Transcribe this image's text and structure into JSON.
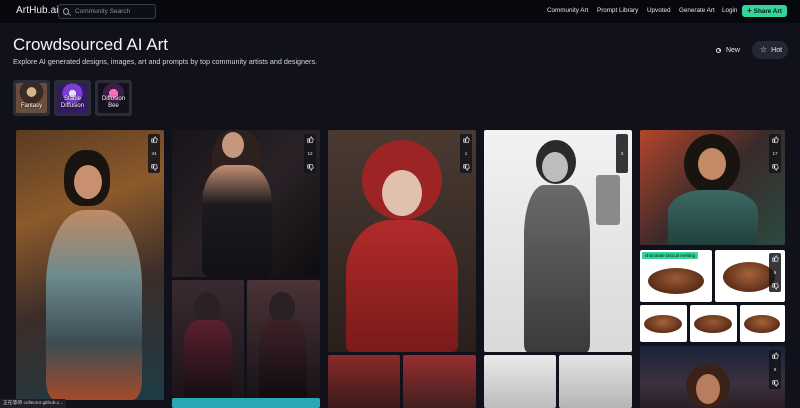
{
  "header": {
    "logo": "ArtHub.ai",
    "search_placeholder": "Community Search",
    "nav": [
      "Community Art",
      "Prompt Library",
      "Upvoted",
      "Generate Art",
      "Login"
    ],
    "share_label": "Share Art"
  },
  "hero": {
    "title": "Crowdsourced AI Art",
    "subtitle": "Explore AI generated designs, images, art and prompts by top community artists and designers."
  },
  "sort": {
    "new_label": "New",
    "hot_label": "Hot"
  },
  "categories": [
    {
      "lines": [
        "Fantasy"
      ]
    },
    {
      "lines": [
        "Stable",
        "Diffusion"
      ]
    },
    {
      "lines": [
        "Diffusion",
        "Bee"
      ]
    }
  ],
  "cards": {
    "votes": [
      "44",
      "12",
      "1",
      "3",
      "17",
      "6",
      "9"
    ],
    "tag": "chocolate biscuit melting"
  },
  "statusbar": "正在等待 collector.github.c..."
}
